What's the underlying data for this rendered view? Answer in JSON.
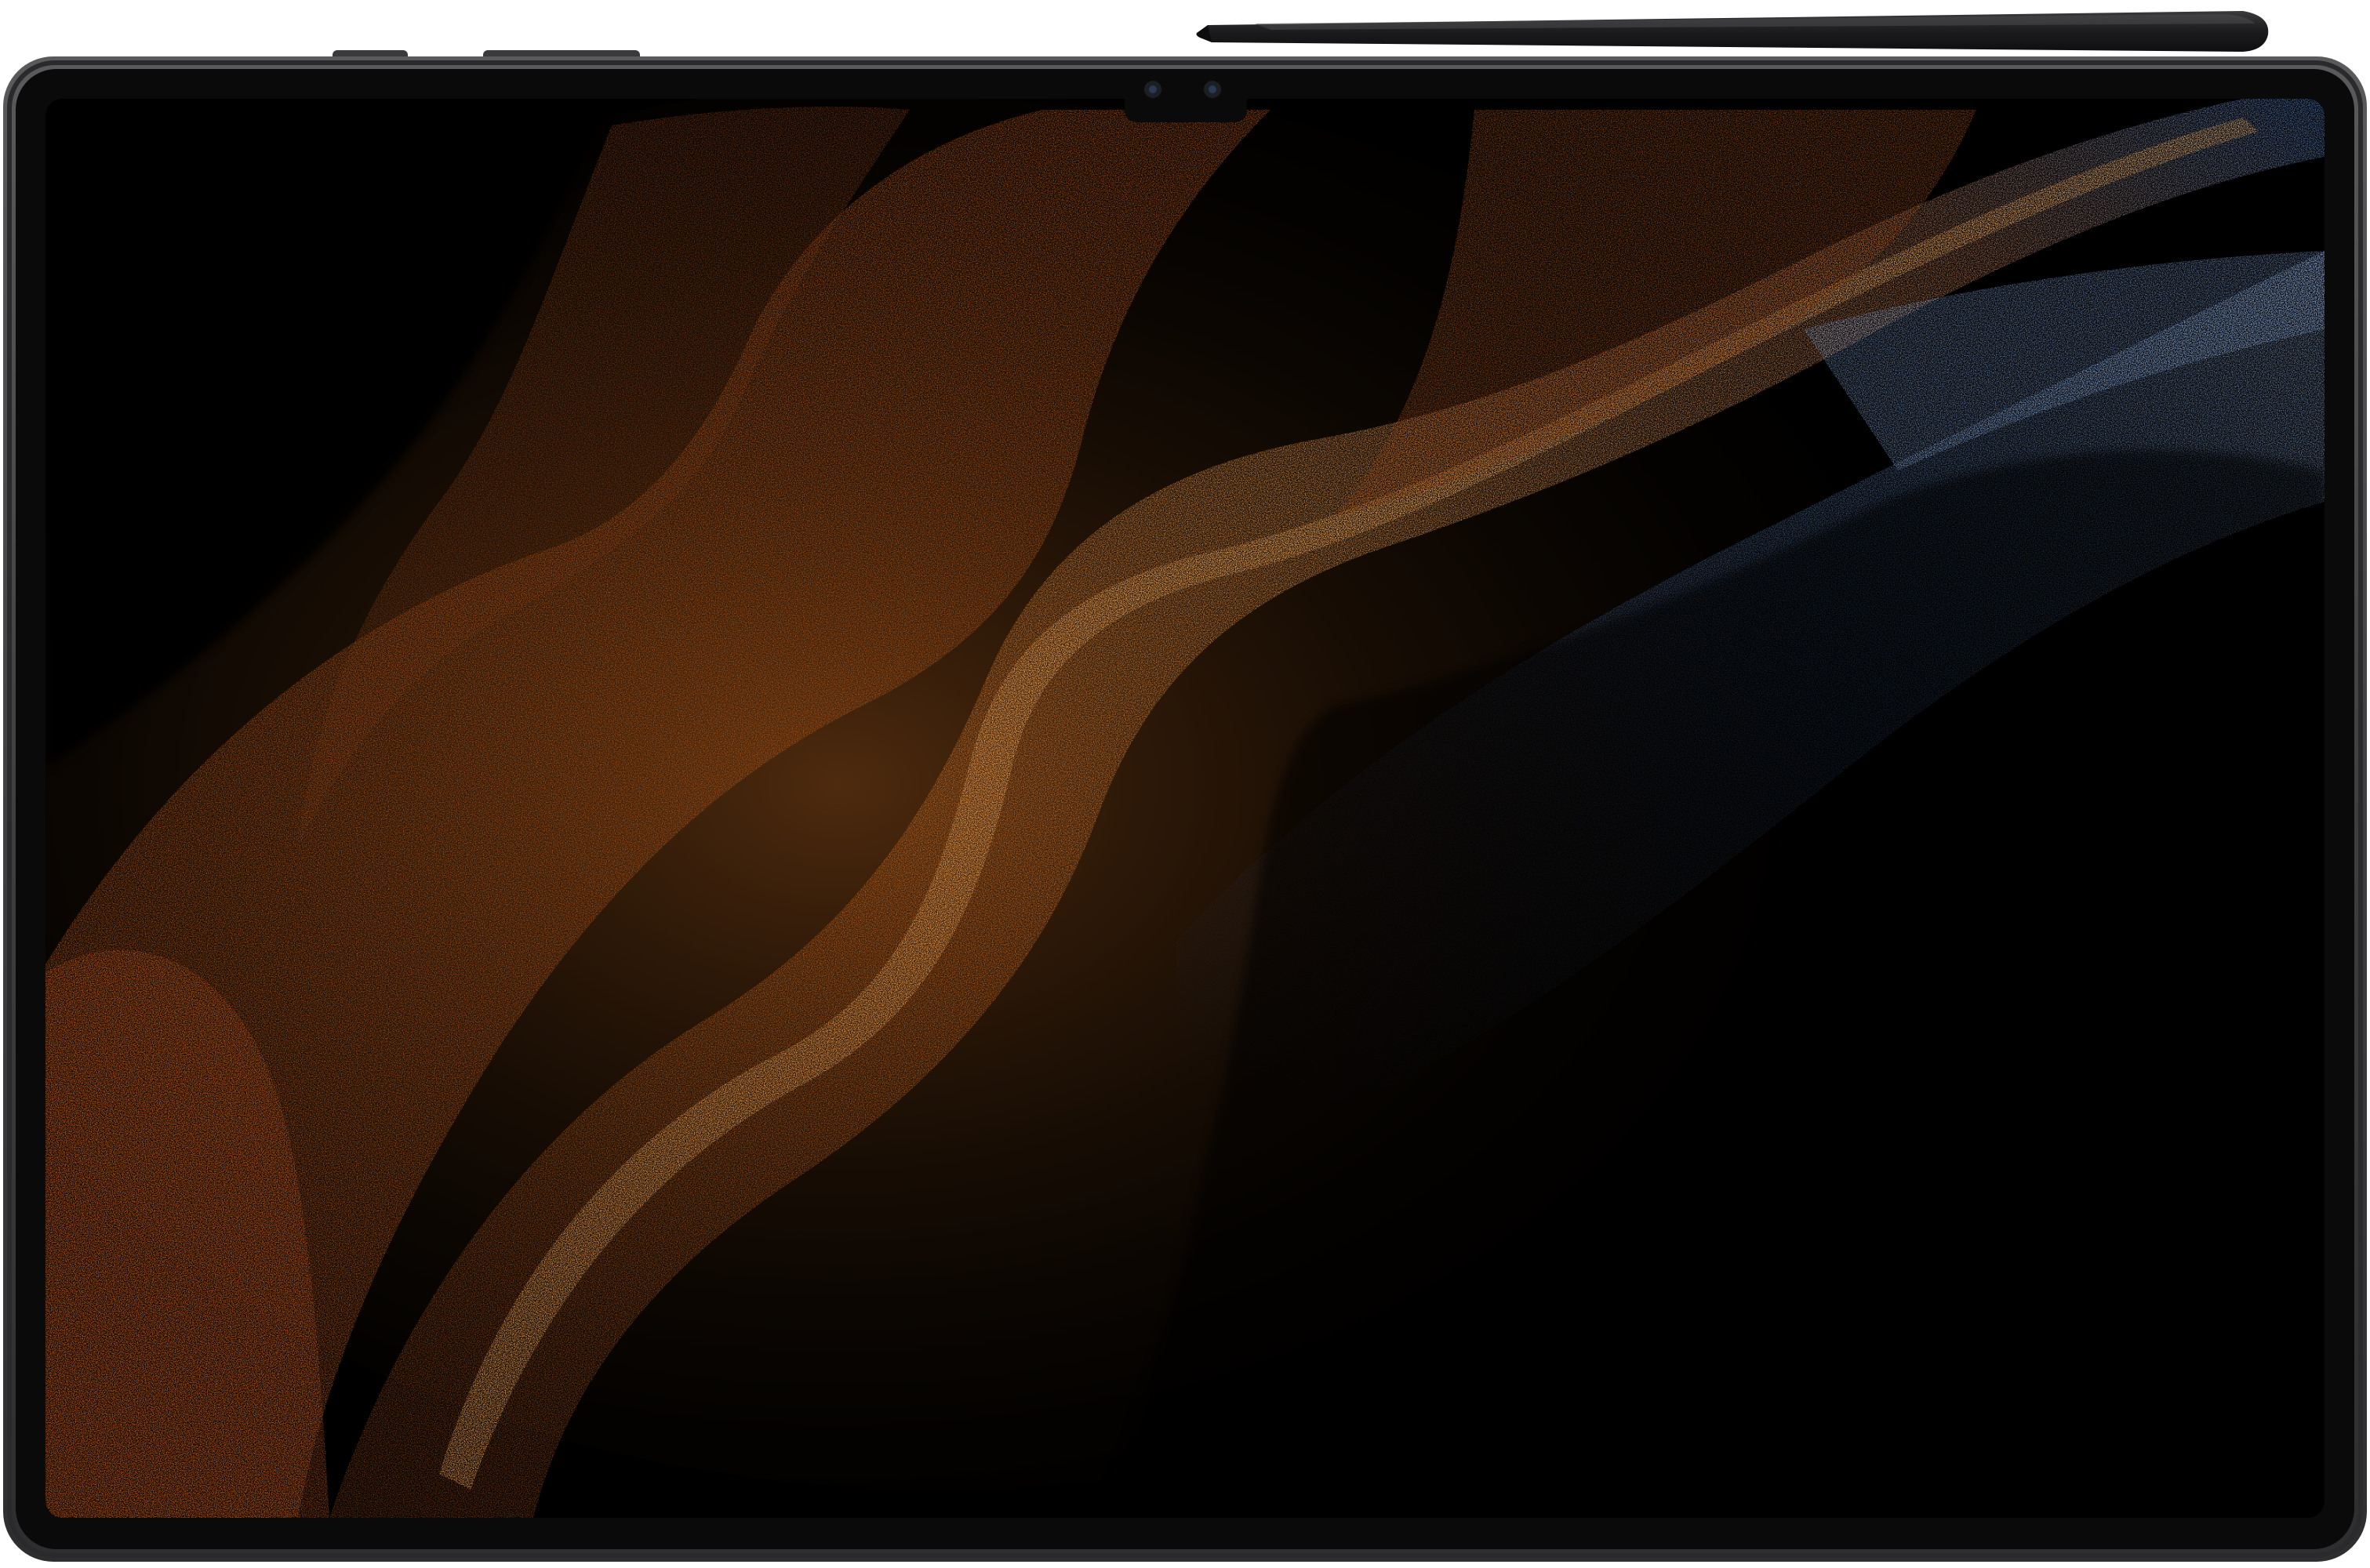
{
  "scene": {
    "subject": "tablet-with-stylus",
    "view": "front",
    "orientation": "landscape",
    "screen_state": "on",
    "screen_content": "wallpaper-particle-waves",
    "text_content": []
  },
  "colors": {
    "background": "#ffffff",
    "frame": "#4a4a4c",
    "frame_edge": "#2a2a2c",
    "bezel": "#0a0a0b",
    "screen": "#000000",
    "notch": "#0a0a0b",
    "camera": "#1c1f24",
    "camera_lens": "#2a3a55",
    "stylus_body": "#1e1e20",
    "stylus_highlight": "#3a3a3d",
    "wave_orange_dark": "#7a3b12",
    "wave_orange": "#d06a1e",
    "wave_orange_bright": "#f0a050",
    "wave_blue": "#5a8fd8",
    "wave_blue_pale": "#a9c4ef"
  },
  "icons": [
    "front-camera-icon",
    "front-camera-icon",
    "stylus-icon"
  ]
}
